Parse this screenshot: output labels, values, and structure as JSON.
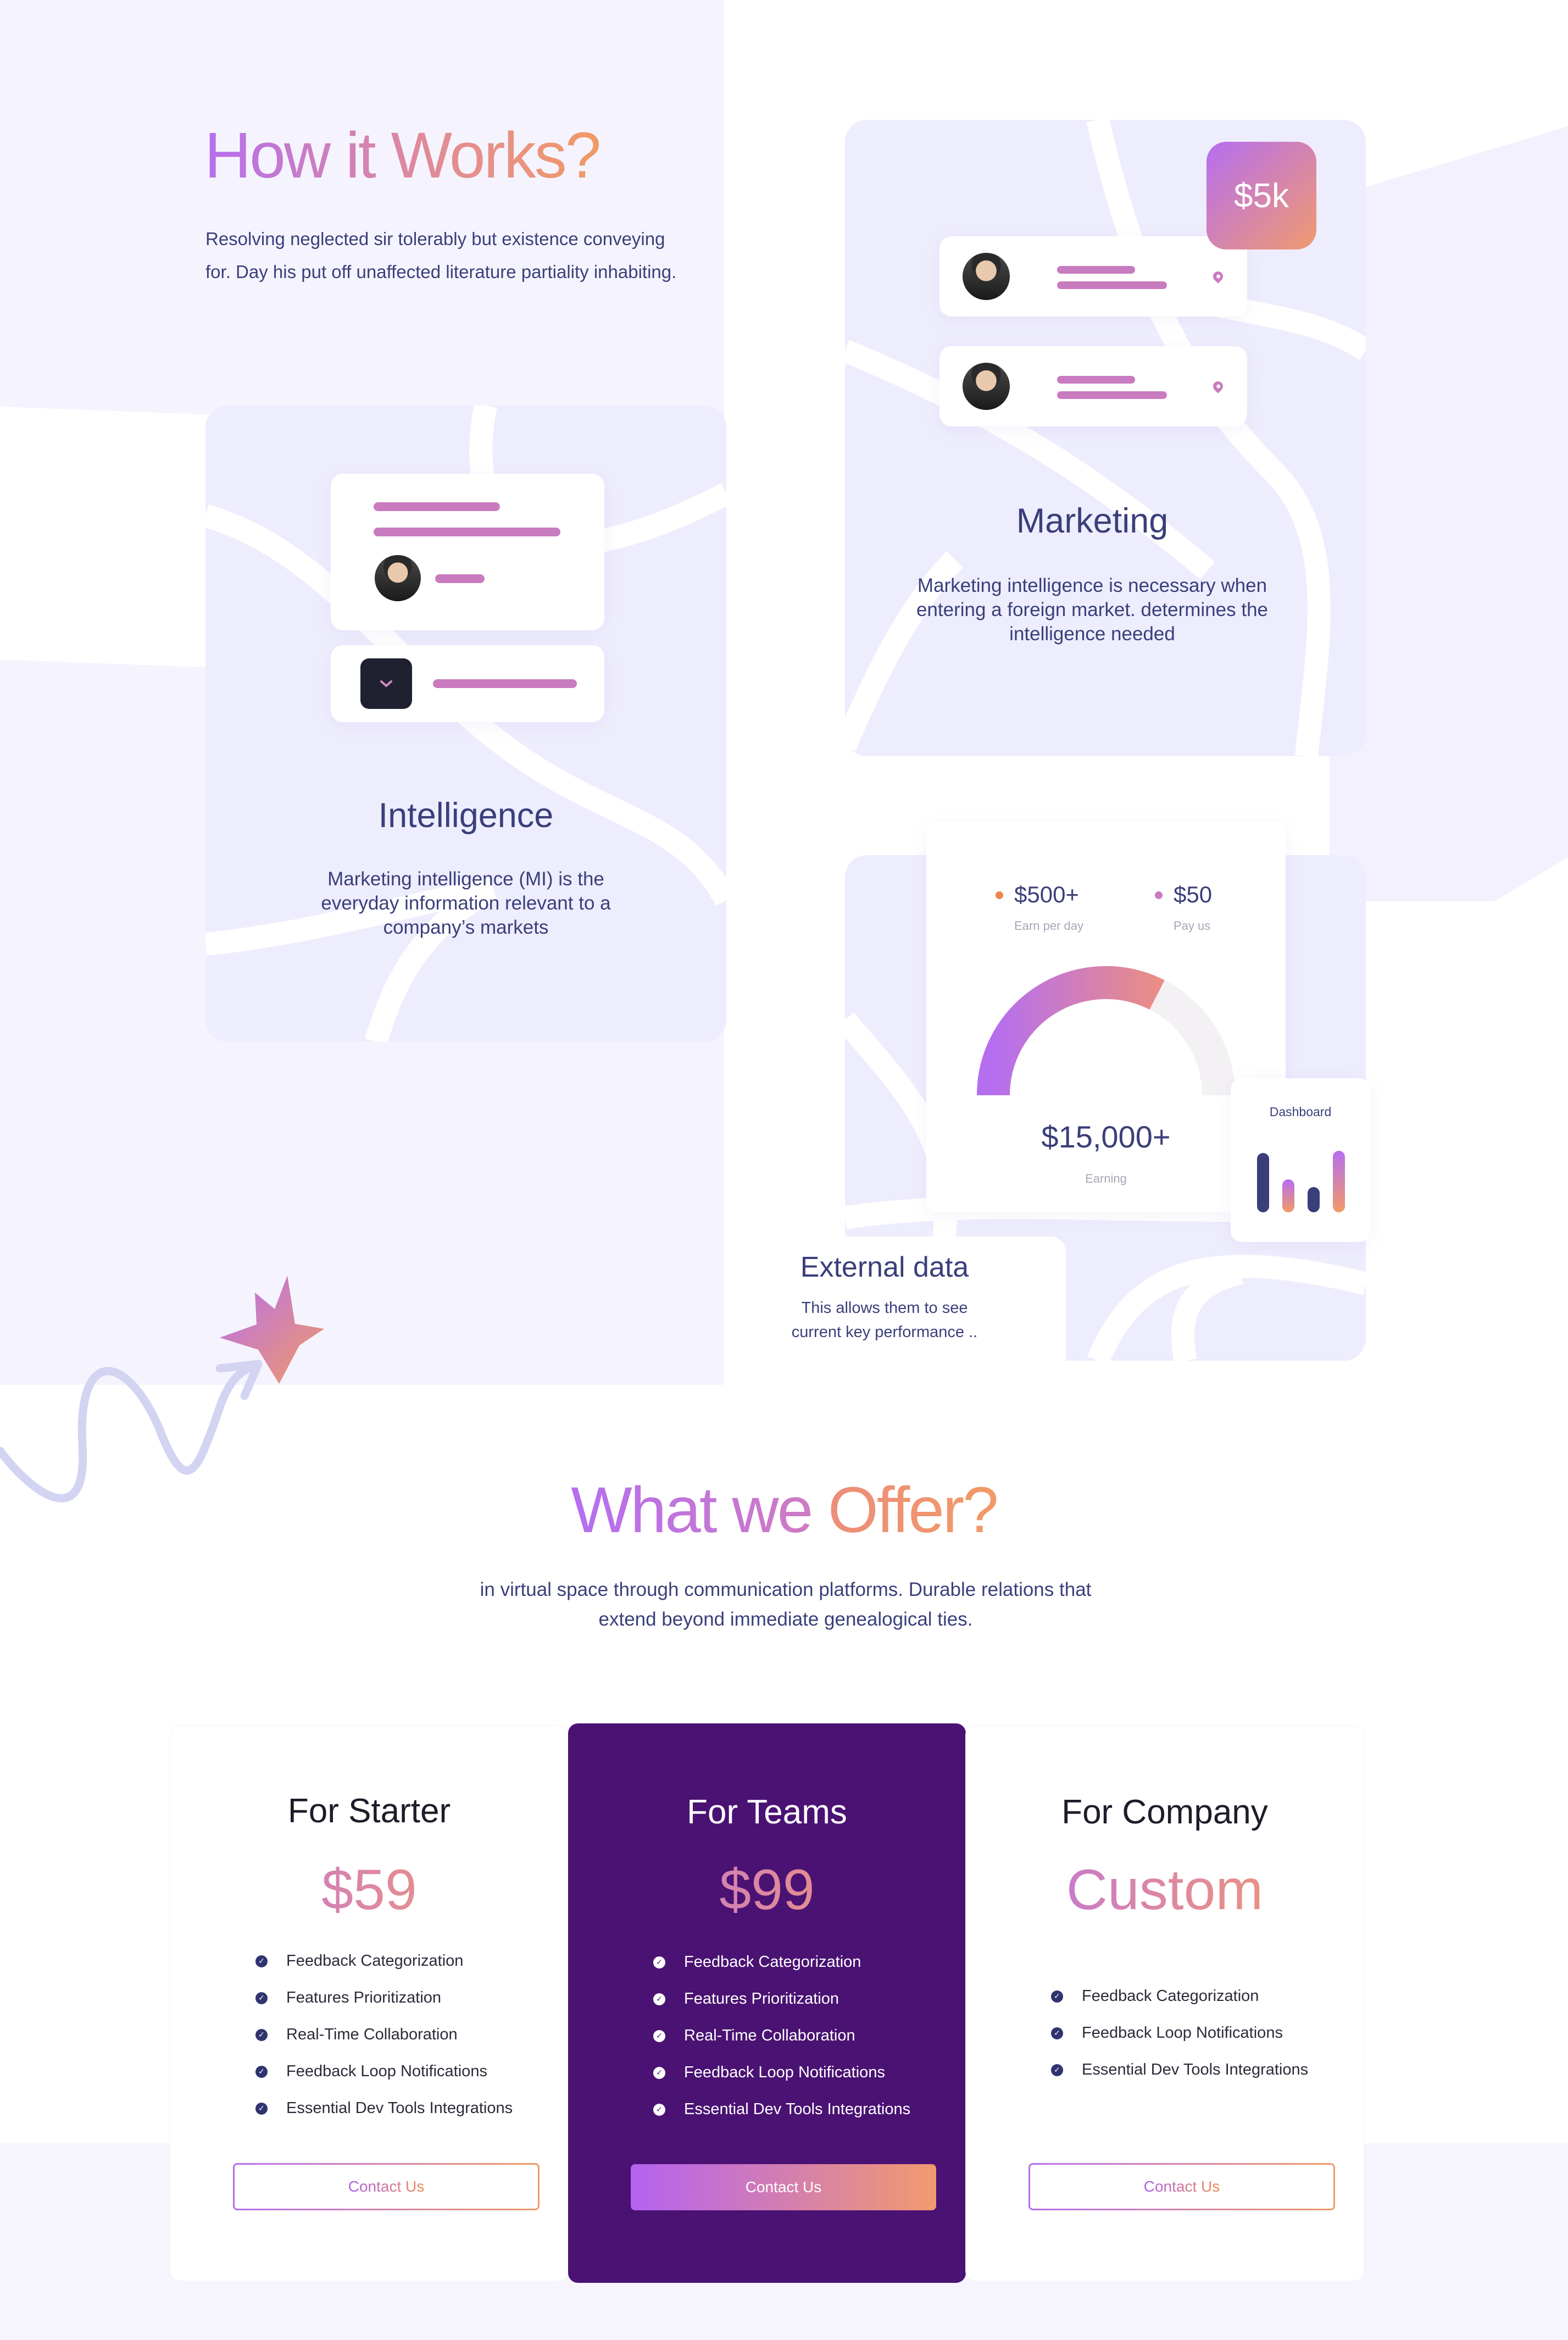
{
  "how_it_works": {
    "title": "How it Works?",
    "description": "Resolving neglected sir tolerably but existence conveying for. Day his put off unaffected literature partiality inhabiting."
  },
  "intelligence": {
    "title": "Intelligence",
    "description": "Marketing intelligence (MI) is the everyday information relevant to a company’s markets"
  },
  "marketing": {
    "badge": "$5k",
    "title": "Marketing",
    "description": "Marketing intelligence is necessary when entering a foreign market. determines the intelligence needed"
  },
  "external_data": {
    "stat1_value": "$500+",
    "stat1_label": "Earn per day",
    "stat2_value": "$50",
    "stat2_label": "Pay us",
    "gauge_fraction": 0.65,
    "earning_value": "$15,000+",
    "earning_label": "Earning",
    "dashboard_label": "Dashboard",
    "dashboard_bars": [
      0.75,
      0.42,
      0.32,
      0.78
    ],
    "title": "External data",
    "description": "This allows them to see current key performance .."
  },
  "offer": {
    "title_part1": "What we ",
    "title_part2": "Offer?",
    "description": "in virtual space through communication platforms. Durable relations that extend beyond immediate genealogical ties."
  },
  "plans": [
    {
      "name": "For Starter",
      "price": "$59",
      "features": [
        "Feedback Categorization",
        "Features Prioritization",
        "Real-Time Collaboration",
        "Feedback Loop Notifications",
        "Essential Dev Tools Integrations"
      ],
      "button": "Contact Us"
    },
    {
      "name": "For Teams",
      "price": "$99",
      "features": [
        "Feedback Categorization",
        "Features Prioritization",
        "Real-Time Collaboration",
        "Feedback Loop Notifications",
        "Essential Dev Tools Integrations"
      ],
      "button": "Contact Us"
    },
    {
      "name": "For Company",
      "price": "Custom",
      "features": [
        "Feedback Categorization",
        "Feedback Loop Notifications",
        "Essential Dev Tools Integrations"
      ],
      "button": "Contact Us"
    }
  ],
  "colors": {
    "navy": "#3a3f7a",
    "lavender": "#eeedfd",
    "purple_card": "#4a1273",
    "accent_pink": "#c97bc0",
    "gradient_start": "#b56ef0",
    "gradient_end": "#f19a67"
  }
}
